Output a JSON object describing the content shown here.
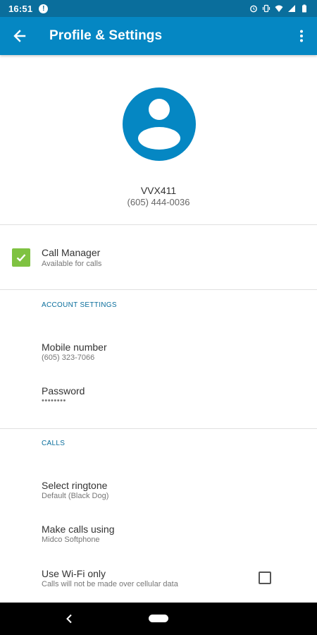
{
  "status_bar": {
    "time": "16:51",
    "alert": "!",
    "icons": [
      "alarm-icon",
      "vibrate-icon",
      "wifi-icon",
      "signal-icon",
      "battery-icon"
    ]
  },
  "app_bar": {
    "title": "Profile & Settings",
    "back_icon": "arrow-left-icon",
    "menu_icon": "more-vert-icon"
  },
  "profile": {
    "name": "VVX411",
    "phone": "(605) 444-0036"
  },
  "call_manager": {
    "title": "Call Manager",
    "subtitle": "Available for calls",
    "checked": true
  },
  "account_settings": {
    "header": "ACCOUNT SETTINGS",
    "items": [
      {
        "title": "Mobile number",
        "subtitle": "(605) 323-7066"
      },
      {
        "title": "Password",
        "subtitle": "••••••••"
      }
    ]
  },
  "calls": {
    "header": "CALLS",
    "items": [
      {
        "title": "Select ringtone",
        "subtitle": "Default (Black Dog)"
      },
      {
        "title": "Make calls using",
        "subtitle": "Midco Softphone"
      },
      {
        "title": "Use Wi-Fi only",
        "subtitle": "Calls will not be made over cellular data",
        "checked": false
      }
    ]
  },
  "colors": {
    "status_bar": "#0a6e9c",
    "app_bar": "#0587c3",
    "accent": "#0587c3",
    "checkbox": "#7fc241"
  }
}
